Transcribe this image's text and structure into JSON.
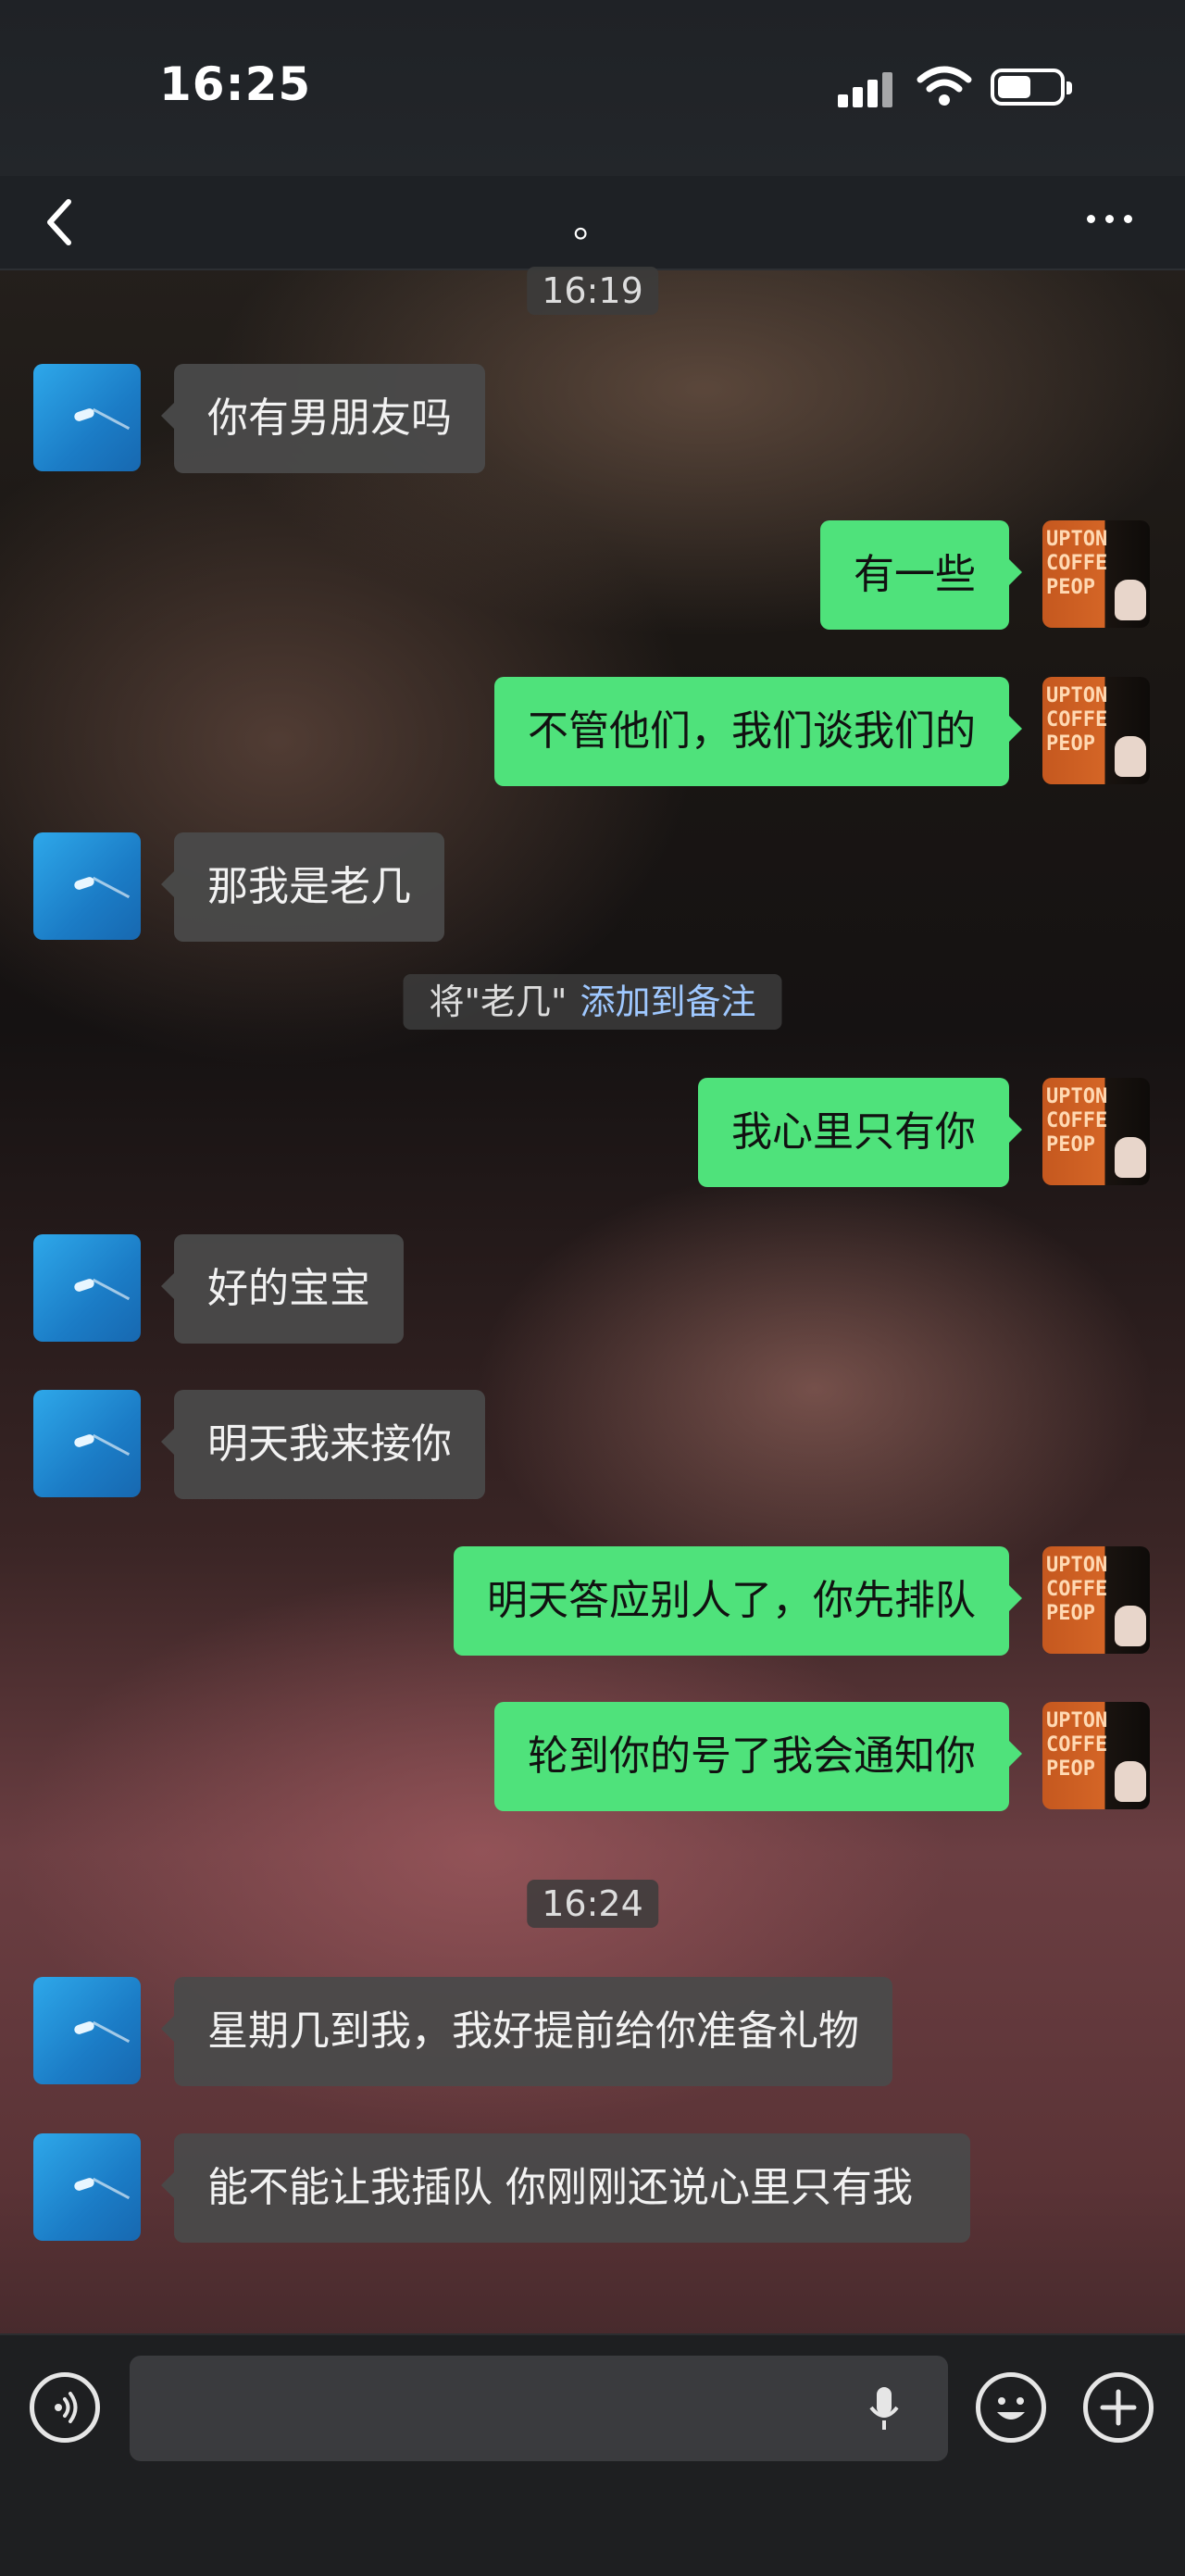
{
  "status_bar": {
    "time": "16:25",
    "battery_level": 0.55
  },
  "nav": {
    "title": "。",
    "back_icon": "chevron-left-icon",
    "more_icon": "more-icon"
  },
  "timestamps": [
    "16:19",
    "16:24"
  ],
  "messages": [
    {
      "side": "in",
      "text": "你有男朋友吗"
    },
    {
      "side": "out",
      "text": "有一些"
    },
    {
      "side": "out",
      "text": "不管他们，我们谈我们的"
    },
    {
      "side": "in",
      "text": "那我是老几"
    },
    {
      "side": "out",
      "text": "我心里只有你"
    },
    {
      "side": "in",
      "text": "好的宝宝"
    },
    {
      "side": "in",
      "text": "明天我来接你"
    },
    {
      "side": "out",
      "text": "明天答应别人了，你先排队"
    },
    {
      "side": "out",
      "text": "轮到你的号了我会通知你"
    },
    {
      "side": "in",
      "text": "星期几到我，我好提前给你准备礼物"
    },
    {
      "side": "in",
      "text": "能不能让我插队 你刚刚还说心里只有我"
    }
  ],
  "system_note": {
    "prefix": "将\"老几\"",
    "link": "添加到备注"
  },
  "avatars": {
    "other": "sea-boat-avatar",
    "me_text": "UPTON COFFE PEOP"
  },
  "input_bar": {
    "voice_icon": "voice-icon",
    "mic_icon": "mic-icon",
    "emoji_icon": "emoji-icon",
    "plus_icon": "plus-icon"
  },
  "colors": {
    "out_bubble": "#4fe27b",
    "in_bubble": "#4a4a4a",
    "link": "#9fc8ff"
  }
}
